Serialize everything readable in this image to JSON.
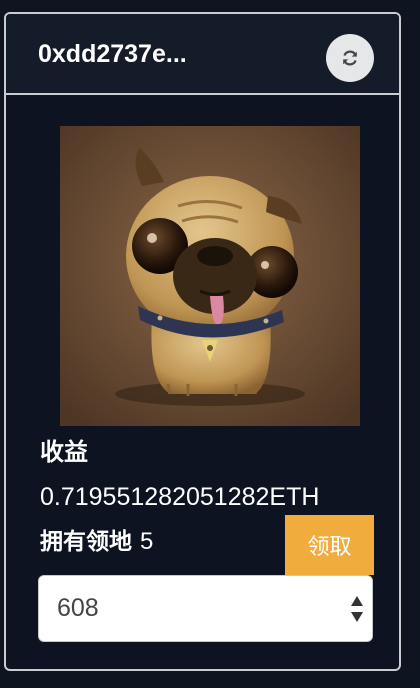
{
  "header": {
    "address": "0xdd2737e..."
  },
  "icons": {
    "refresh": "refresh-icon",
    "select_arrows": "updown-arrows-icon"
  },
  "stats": {
    "earnings_label": "收益",
    "earnings_value": "0.719551282051282ETH",
    "owned_label": "拥有领地",
    "owned_count": "5"
  },
  "actions": {
    "claim_label": "领取"
  },
  "selector": {
    "value": "608"
  },
  "colors": {
    "background": "#0f1520",
    "accent": "#f0ad3e",
    "border": "#c9ccd1"
  }
}
